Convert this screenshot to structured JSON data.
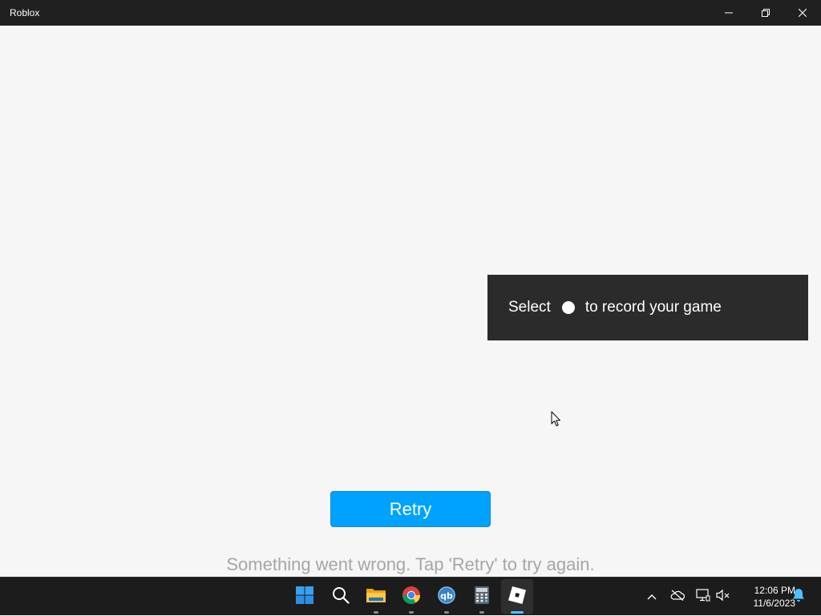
{
  "window": {
    "title": "Roblox",
    "controls": {
      "minimize_icon": "minimize-icon",
      "restore_icon": "restore-icon",
      "close_icon": "close-icon"
    }
  },
  "toast": {
    "prefix": "Select",
    "suffix": "to record your game",
    "record_icon": "record-dot-icon"
  },
  "main": {
    "retry_label": "Retry",
    "error_message": "Something went wrong. Tap 'Retry' to try again."
  },
  "taskbar": {
    "apps": [
      {
        "name": "start",
        "icon": "windows-logo-icon"
      },
      {
        "name": "search",
        "icon": "search-icon"
      },
      {
        "name": "file-explorer",
        "icon": "folder-icon"
      },
      {
        "name": "chrome",
        "icon": "chrome-icon"
      },
      {
        "name": "qbittorrent",
        "icon": "qbittorrent-icon",
        "text": "qb"
      },
      {
        "name": "calculator",
        "icon": "calculator-icon"
      },
      {
        "name": "roblox",
        "icon": "roblox-icon",
        "active": true
      }
    ],
    "tray": {
      "icons": [
        "chevron-up-icon",
        "onedrive-offline-icon",
        "network-icon",
        "volume-muted-icon",
        "notification-bell-icon"
      ],
      "time": "12:06 PM",
      "date": "11/6/2023"
    }
  },
  "colors": {
    "titlebar": "#202020",
    "background": "#f6f6f6",
    "toast": "#2b2b2b",
    "retry_button": "#00a2ff",
    "error_text": "#a6a6a6",
    "taskbar": "#1c1c1c",
    "accent": "#4cc2ff"
  }
}
